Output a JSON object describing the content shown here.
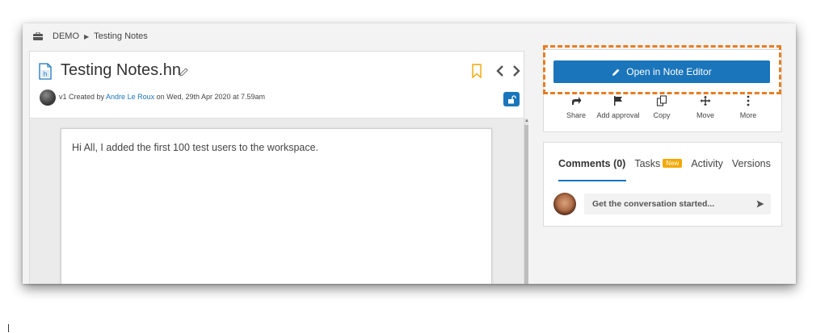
{
  "breadcrumb": {
    "workspace": "DEMO",
    "page": "Testing Notes"
  },
  "document": {
    "title": "Testing Notes.hn",
    "meta_prefix": "v1 Created by ",
    "author": "Andre Le Roux",
    "meta_suffix": " on Wed, 29th Apr 2020 at 7.59am",
    "body_text": "Hi All, I added the first 100 test users to the workspace."
  },
  "actions": {
    "open_editor_label": "Open in Note Editor",
    "items": [
      {
        "label": "Share",
        "icon": "share-icon"
      },
      {
        "label": "Add approval",
        "icon": "flag-icon"
      },
      {
        "label": "Copy",
        "icon": "copy-icon"
      },
      {
        "label": "Move",
        "icon": "move-icon"
      },
      {
        "label": "More",
        "icon": "more-vertical-icon"
      }
    ]
  },
  "comments": {
    "tabs": [
      {
        "label": "Comments (0)",
        "active": true
      },
      {
        "label": "Tasks",
        "badge": "New"
      },
      {
        "label": "Activity"
      },
      {
        "label": "Versions"
      }
    ],
    "input_placeholder": "Get the conversation started..."
  },
  "colors": {
    "primary": "#1a75bb",
    "highlight": "#e67e22",
    "badge": "#f2a900",
    "bookmark": "#f2a900"
  }
}
